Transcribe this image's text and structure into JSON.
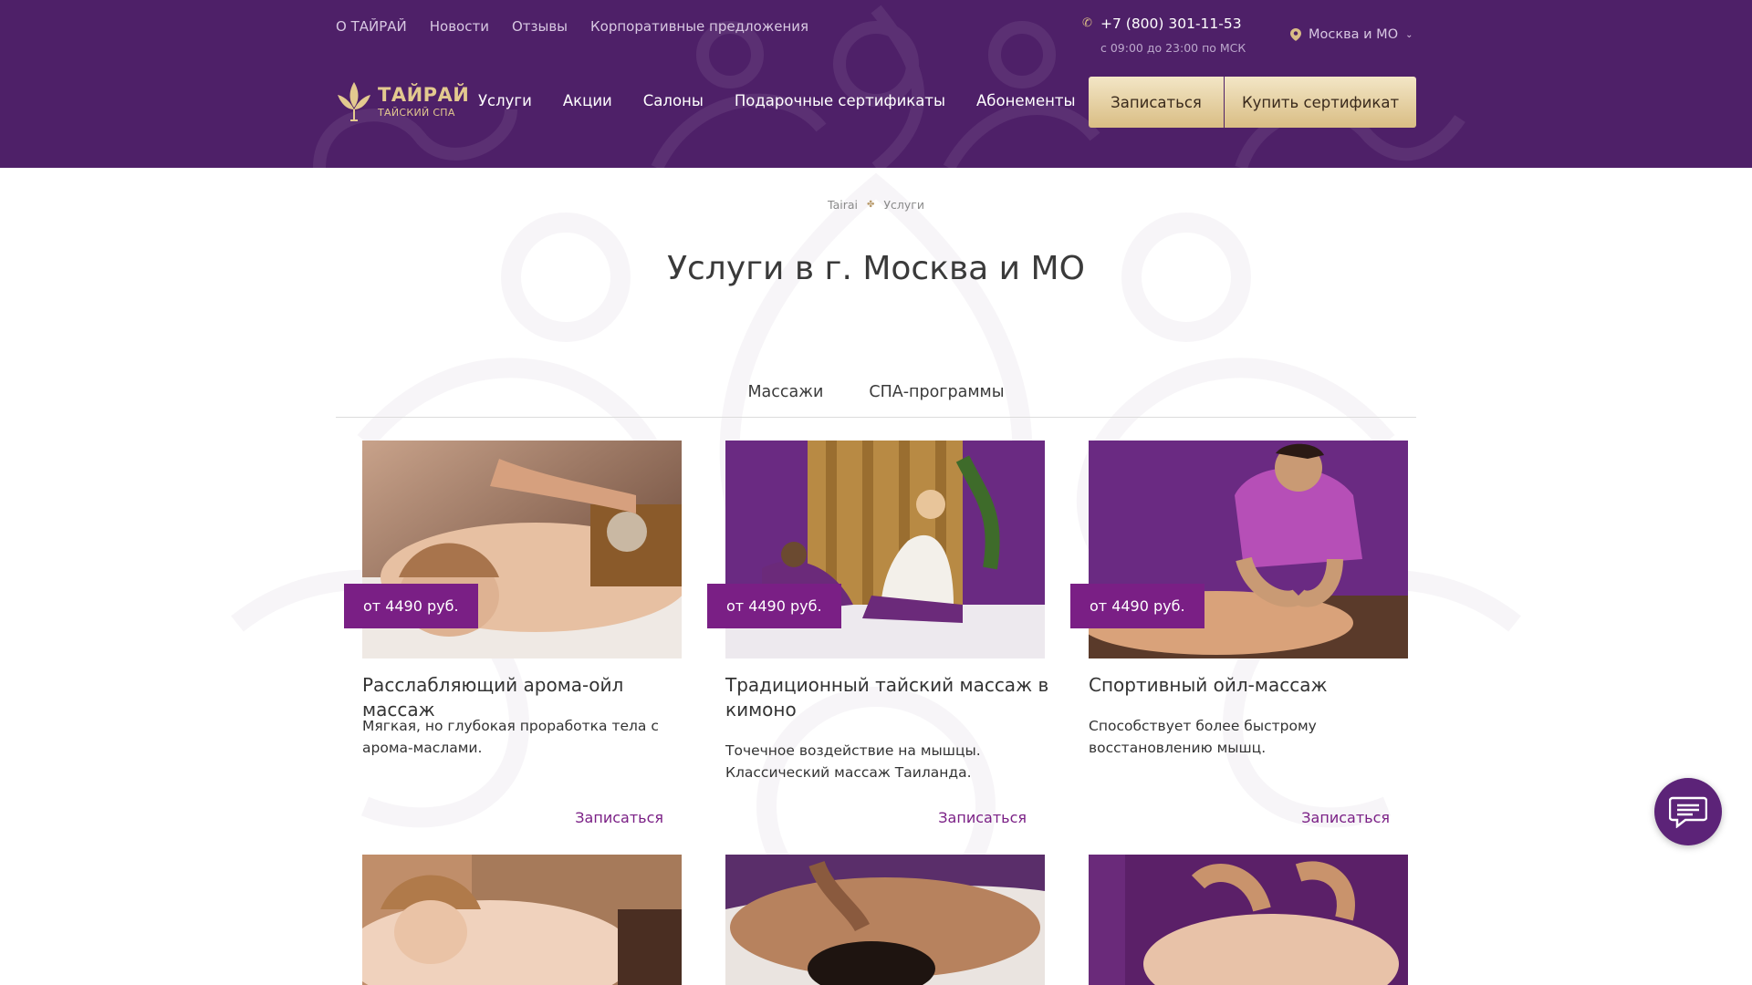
{
  "header": {
    "top_links": [
      "О ТАЙРАЙ",
      "Новости",
      "Отзывы",
      "Корпоративные предложения"
    ],
    "phone": "+7 (800) 301-11-53",
    "hours": "с 09:00 до 23:00 по МСК",
    "city": "Москва и МО",
    "logo": {
      "name": "ТАЙРАЙ",
      "subtitle": "ТАЙСКИЙ СПА"
    },
    "nav": [
      "Услуги",
      "Акции",
      "Салоны",
      "Подарочные сертификаты",
      "Абонементы"
    ],
    "book_button": "Записаться",
    "certificate_button": "Купить сертификат"
  },
  "breadcrumb": [
    "Tairai",
    "Услуги"
  ],
  "page_title": "Услуги в г. Москва и МО",
  "tabs": [
    "Массажи",
    "СПА-программы"
  ],
  "cards": [
    {
      "price": "от 4490 руб.",
      "title": "Расслабляющий арома-ойл массаж",
      "description": "Мягкая, но глубокая проработка тела с арома-маслами.",
      "link": "Записаться"
    },
    {
      "price": "от 4490 руб.",
      "title": "Традиционный тайский массаж в кимоно",
      "description": "Точечное воздействие на мышцы. Классический массаж Таиланда.",
      "link": "Записаться"
    },
    {
      "price": "от 4490 руб.",
      "title": "Спортивный ойл-массаж",
      "description": "Способствует более быстрому восстановлению мышц.",
      "link": "Записаться"
    }
  ],
  "icons": {
    "phone": "phone-icon",
    "city": "location-pin-icon",
    "city_dropdown": "chevron-down-icon",
    "chat": "chat-icon"
  },
  "colors": {
    "header_bg": "#4e2068",
    "accent_purple": "#7a1f85",
    "gold": "#d9bd84"
  }
}
